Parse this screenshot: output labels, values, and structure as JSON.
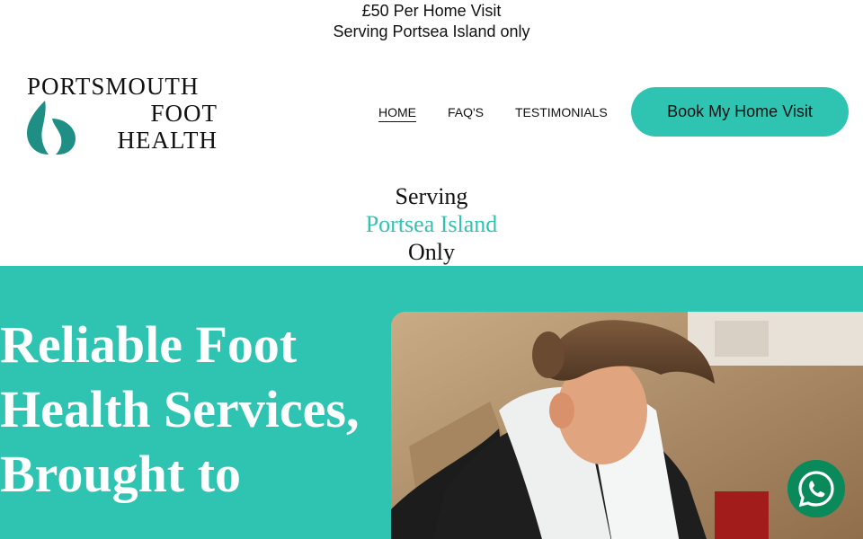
{
  "announcement": {
    "line1": "£50 Per Home Visit",
    "line2": "Serving Portsea Island only"
  },
  "logo": {
    "line1": "PORTSMOUTH",
    "line2": "FOOT",
    "line3": "HEALTH"
  },
  "nav": {
    "home": "HOME",
    "faq": "FAQ'S",
    "testimonials": "TESTIMONIALS"
  },
  "cta_label": "Book My Home Visit",
  "serving": {
    "line1": "Serving",
    "line2": "Portsea Island",
    "line3": "Only"
  },
  "hero": {
    "title": "Reliable Foot Health Services, Brought to"
  },
  "colors": {
    "accent": "#2fc4b2",
    "whatsapp": "#0a8a5a"
  },
  "icons": {
    "logo_mark": "foot-leaf-icon",
    "chat": "whatsapp-icon"
  }
}
